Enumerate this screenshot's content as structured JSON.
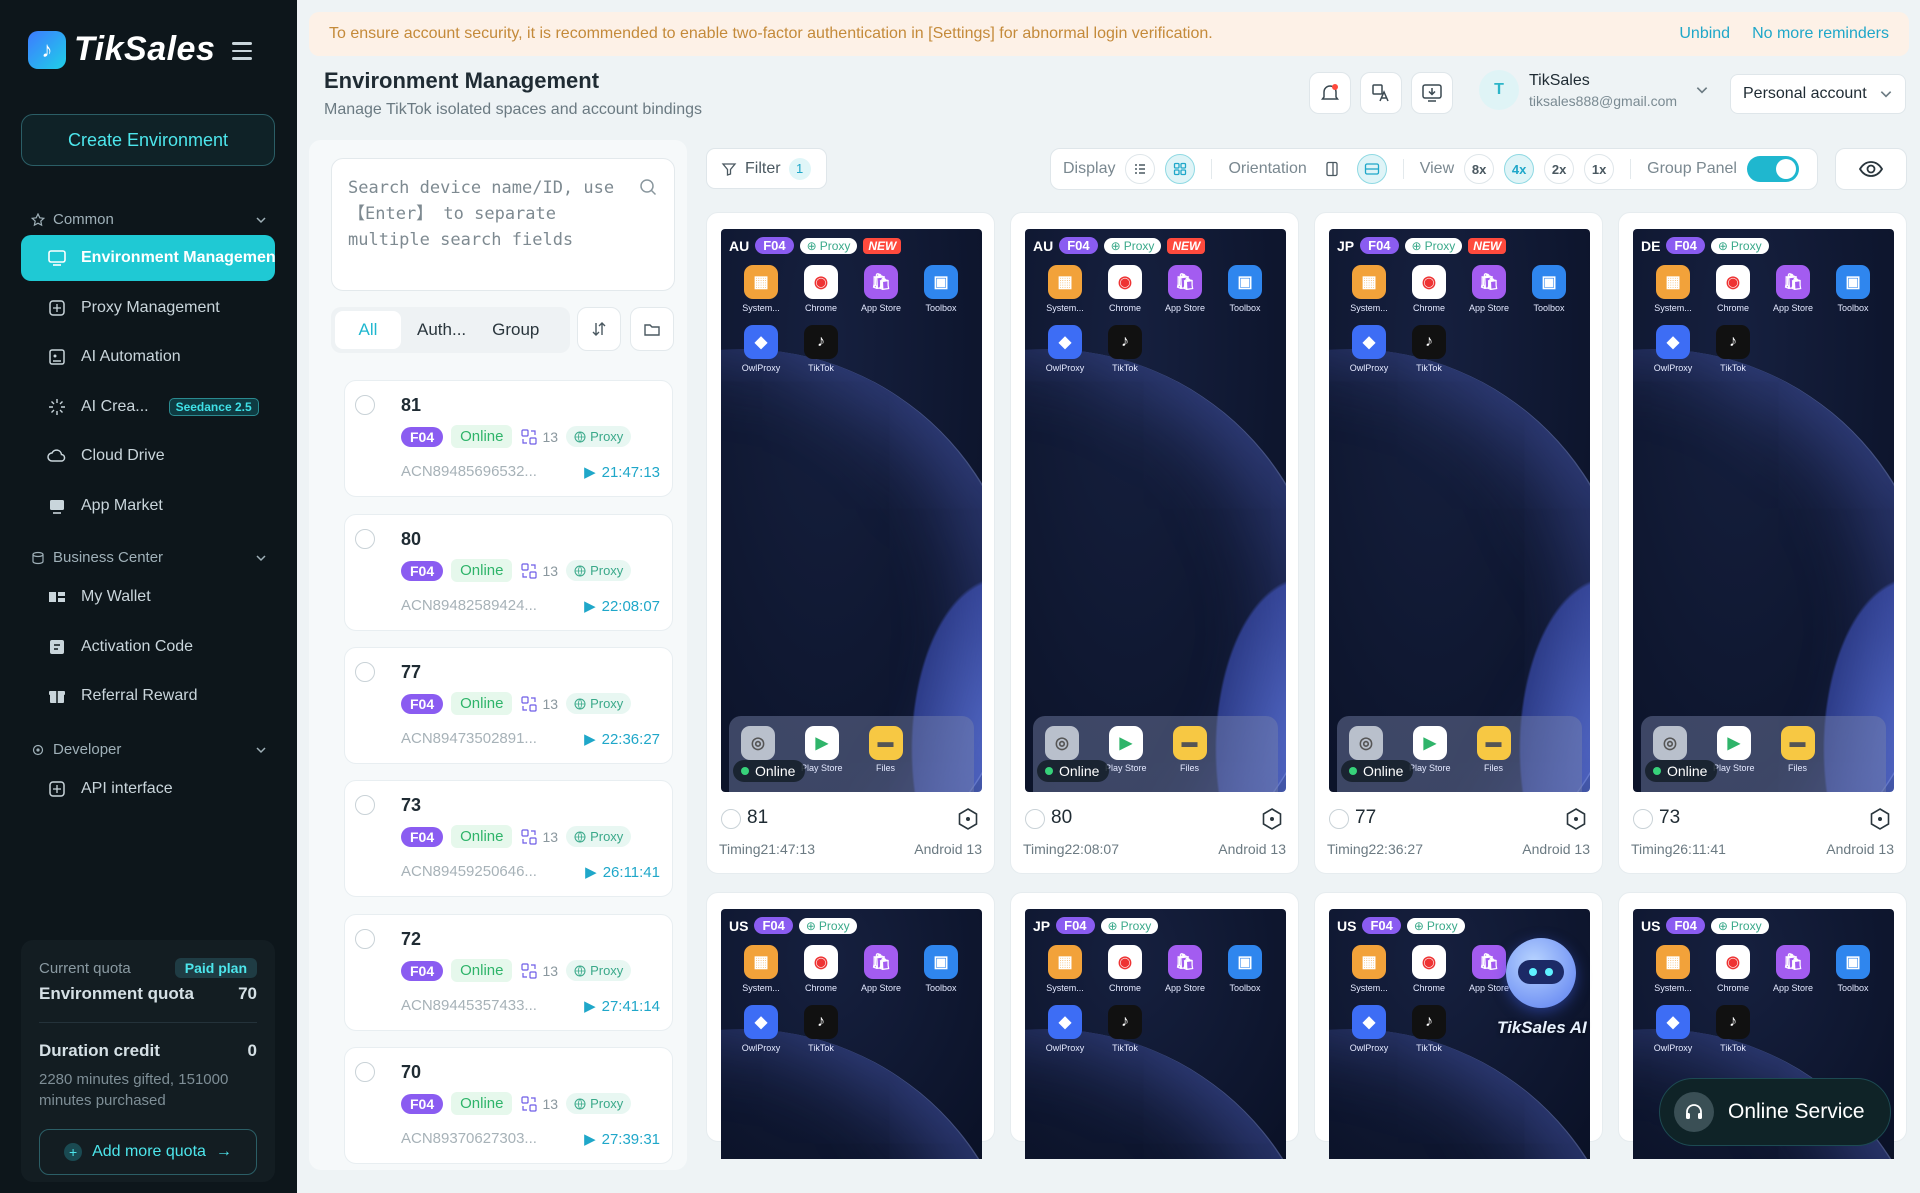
{
  "sidebar": {
    "brand": "TikSales",
    "create_button": "Create Environment",
    "sections": {
      "common": "Common",
      "business": "Business Center",
      "developer": "Developer"
    },
    "items": [
      {
        "label": "Environment Management",
        "active": true
      },
      {
        "label": "Proxy Management"
      },
      {
        "label": "AI Automation"
      },
      {
        "label": "AI Crea...",
        "badge": "Seedance 2.5"
      },
      {
        "label": "Cloud Drive"
      },
      {
        "label": "App Market"
      },
      {
        "label": "My Wallet"
      },
      {
        "label": "Activation Code"
      },
      {
        "label": "Referral Reward"
      },
      {
        "label": "API interface"
      }
    ],
    "quota": {
      "current_label": "Current quota",
      "plan": "Paid plan",
      "env_label": "Environment quota",
      "env_value": "70",
      "duration_label": "Duration credit",
      "duration_value": "0",
      "note": "2280 minutes gifted, 151000 minutes purchased",
      "add_button": "Add more quota"
    }
  },
  "notice": {
    "text": "To ensure account security, it is recommended to enable two-factor authentication in [Settings] for abnormal login verification.",
    "unbind": "Unbind",
    "dismiss": "No more reminders"
  },
  "header": {
    "title": "Environment Management",
    "subtitle": "Manage TikTok isolated spaces and account bindings",
    "user_initial": "T",
    "user_name": "TikSales",
    "user_email": "tiksales888@gmail.com",
    "account_type": "Personal account"
  },
  "list": {
    "search_placeholder": "Search device name/ID, use 【Enter】 to separate multiple search fields",
    "tabs": [
      "All",
      "Auth...",
      "Group"
    ],
    "environments": [
      {
        "num": "81",
        "tag": "F04",
        "status": "Online",
        "count": "13",
        "proxy": "Proxy",
        "id": "ACN89485696532...",
        "time": "21:47:13"
      },
      {
        "num": "80",
        "tag": "F04",
        "status": "Online",
        "count": "13",
        "proxy": "Proxy",
        "id": "ACN89482589424...",
        "time": "22:08:07"
      },
      {
        "num": "77",
        "tag": "F04",
        "status": "Online",
        "count": "13",
        "proxy": "Proxy",
        "id": "ACN89473502891...",
        "time": "22:36:27"
      },
      {
        "num": "73",
        "tag": "F04",
        "status": "Online",
        "count": "13",
        "proxy": "Proxy",
        "id": "ACN89459250646...",
        "time": "26:11:41"
      },
      {
        "num": "72",
        "tag": "F04",
        "status": "Online",
        "count": "13",
        "proxy": "Proxy",
        "id": "ACN89445357433...",
        "time": "27:41:14"
      },
      {
        "num": "70",
        "tag": "F04",
        "status": "Online",
        "count": "13",
        "proxy": "Proxy",
        "id": "ACN89370627303...",
        "time": "27:39:31"
      }
    ]
  },
  "toolbar": {
    "filter": "Filter",
    "filter_count": "1",
    "display": "Display",
    "orientation": "Orientation",
    "view": "View",
    "views": [
      "8x",
      "4x",
      "2x",
      "1x"
    ],
    "group_panel": "Group Panel"
  },
  "phones": [
    {
      "country": "AU",
      "tag": "F04",
      "proxy": "Proxy",
      "new": "NEW",
      "num": "81",
      "timing": "Timing21:47:13",
      "os": "Android 13",
      "status": "Online"
    },
    {
      "country": "AU",
      "tag": "F04",
      "proxy": "Proxy",
      "new": "NEW",
      "num": "80",
      "timing": "Timing22:08:07",
      "os": "Android 13",
      "status": "Online"
    },
    {
      "country": "JP",
      "tag": "F04",
      "proxy": "Proxy",
      "new": "NEW",
      "num": "77",
      "timing": "Timing22:36:27",
      "os": "Android 13",
      "status": "Online"
    },
    {
      "country": "DE",
      "tag": "F04",
      "proxy": "Proxy",
      "num": "73",
      "timing": "Timing26:11:41",
      "os": "Android 13",
      "status": "Online"
    },
    {
      "country": "US",
      "tag": "F04",
      "proxy": "Proxy"
    },
    {
      "country": "JP",
      "tag": "F04",
      "proxy": "Proxy"
    },
    {
      "country": "US",
      "tag": "F04",
      "proxy": "Proxy"
    },
    {
      "country": "US",
      "tag": "F04",
      "proxy": "Proxy"
    }
  ],
  "phone_apps": {
    "home": [
      "System...",
      "Chrome",
      "App Store",
      "Toolbox",
      "OwlProxy",
      "TikTok"
    ],
    "dock": [
      "",
      "Play Store",
      "Files"
    ]
  },
  "assistant": {
    "label": "TikSales AI"
  },
  "service": {
    "label": "Online Service"
  },
  "colors": {
    "accent": "#1fc9d4",
    "tag_purple": "#8a5cf1",
    "online_green": "#2fb46a"
  }
}
